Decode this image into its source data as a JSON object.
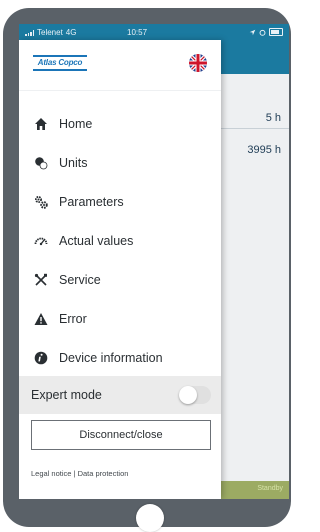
{
  "status_bar": {
    "carrier": "Telenet",
    "network": "4G",
    "time": "10:57"
  },
  "brand": {
    "logo_text": "Atlas Copco",
    "language": "English (UK)"
  },
  "menu": {
    "items": [
      {
        "label": "Home",
        "icon": "home-icon"
      },
      {
        "label": "Units",
        "icon": "units-icon"
      },
      {
        "label": "Parameters",
        "icon": "parameters-icon"
      },
      {
        "label": "Actual values",
        "icon": "gauge-icon"
      },
      {
        "label": "Service",
        "icon": "service-tools-icon"
      },
      {
        "label": "Error",
        "icon": "warning-icon"
      },
      {
        "label": "Device information",
        "icon": "info-icon"
      }
    ]
  },
  "expert_mode": {
    "label": "Expert mode",
    "enabled": false
  },
  "actions": {
    "disconnect_label": "Disconnect/close"
  },
  "footer": {
    "legal": "Legal notice | Data protection"
  },
  "background": {
    "value_1": "5 h",
    "value_2": "3995 h",
    "status": "Standby"
  },
  "colors": {
    "header": "#1b7aa0",
    "brand_blue": "#1b75b8",
    "status_bar_green": "#9cab63"
  }
}
